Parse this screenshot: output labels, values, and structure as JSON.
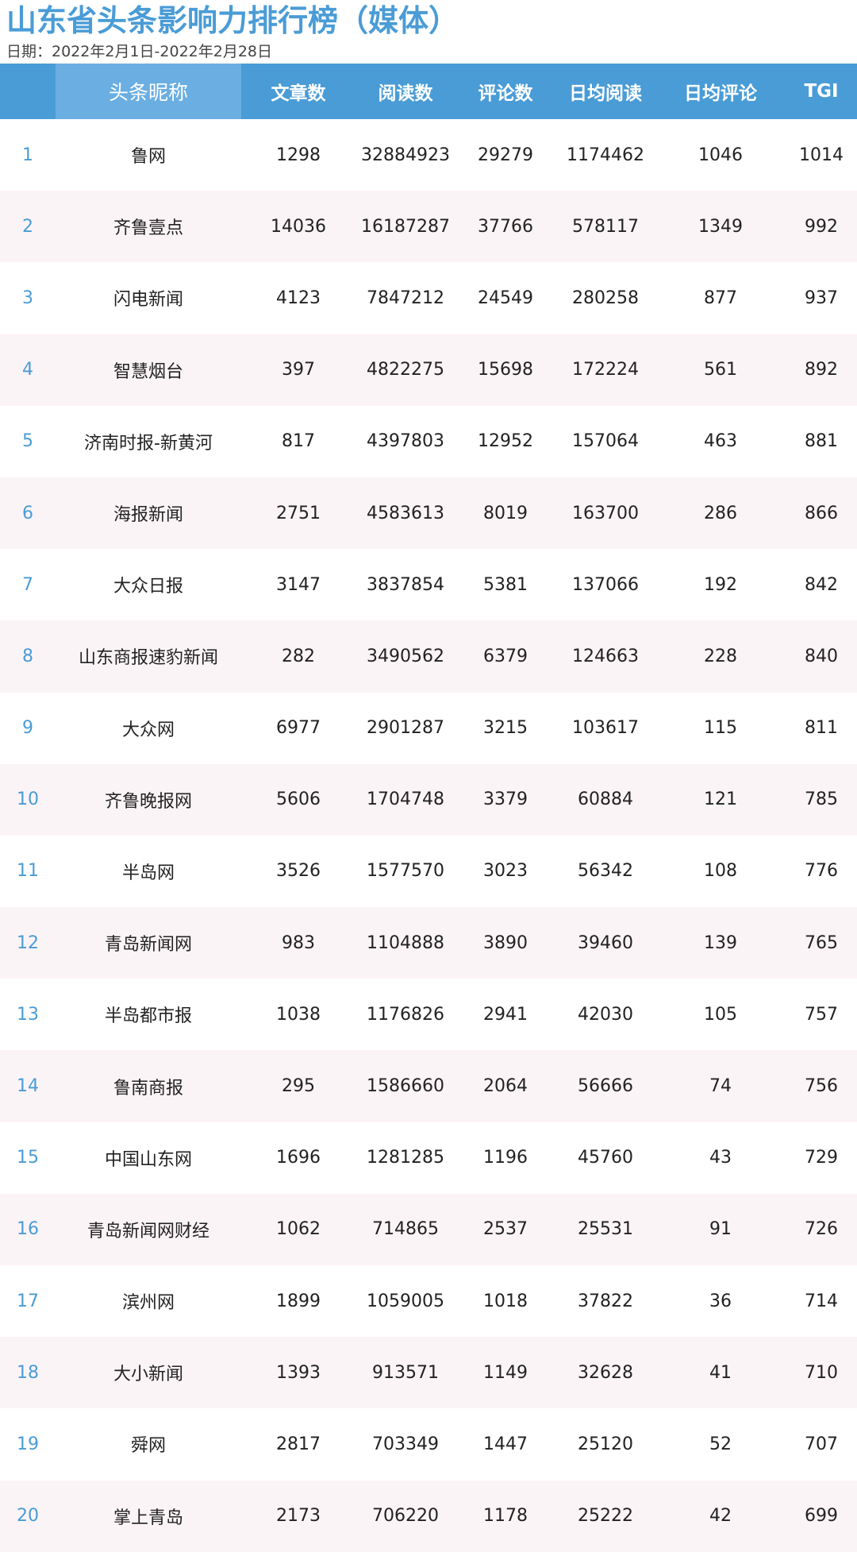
{
  "title": "山东省头条影响力排行榜（媒体）",
  "date_line": "日期：2022年2月1日-2022年2月28日",
  "columns": {
    "rank": "",
    "nickname": "头条昵称",
    "articles": "文章数",
    "reads": "阅读数",
    "comments": "评论数",
    "daily_reads": "日均阅读",
    "daily_comments": "日均评论",
    "tgi": "TGI"
  },
  "colors": {
    "header_bg": "#4a9cd6",
    "header_nick_bg": "#6aaee2",
    "title": "#4a9cd6",
    "row_alt": "#fbf4f6"
  },
  "rows": [
    {
      "rank": "1",
      "nickname": "鲁网",
      "articles": "1298",
      "reads": "32884923",
      "comments": "29279",
      "daily_reads": "1174462",
      "daily_comments": "1046",
      "tgi": "1014"
    },
    {
      "rank": "2",
      "nickname": "齐鲁壹点",
      "articles": "14036",
      "reads": "16187287",
      "comments": "37766",
      "daily_reads": "578117",
      "daily_comments": "1349",
      "tgi": "992"
    },
    {
      "rank": "3",
      "nickname": "闪电新闻",
      "articles": "4123",
      "reads": "7847212",
      "comments": "24549",
      "daily_reads": "280258",
      "daily_comments": "877",
      "tgi": "937"
    },
    {
      "rank": "4",
      "nickname": "智慧烟台",
      "articles": "397",
      "reads": "4822275",
      "comments": "15698",
      "daily_reads": "172224",
      "daily_comments": "561",
      "tgi": "892"
    },
    {
      "rank": "5",
      "nickname": "济南时报-新黄河",
      "articles": "817",
      "reads": "4397803",
      "comments": "12952",
      "daily_reads": "157064",
      "daily_comments": "463",
      "tgi": "881"
    },
    {
      "rank": "6",
      "nickname": "海报新闻",
      "articles": "2751",
      "reads": "4583613",
      "comments": "8019",
      "daily_reads": "163700",
      "daily_comments": "286",
      "tgi": "866"
    },
    {
      "rank": "7",
      "nickname": "大众日报",
      "articles": "3147",
      "reads": "3837854",
      "comments": "5381",
      "daily_reads": "137066",
      "daily_comments": "192",
      "tgi": "842"
    },
    {
      "rank": "8",
      "nickname": "山东商报速豹新闻",
      "articles": "282",
      "reads": "3490562",
      "comments": "6379",
      "daily_reads": "124663",
      "daily_comments": "228",
      "tgi": "840"
    },
    {
      "rank": "9",
      "nickname": "大众网",
      "articles": "6977",
      "reads": "2901287",
      "comments": "3215",
      "daily_reads": "103617",
      "daily_comments": "115",
      "tgi": "811"
    },
    {
      "rank": "10",
      "nickname": "齐鲁晚报网",
      "articles": "5606",
      "reads": "1704748",
      "comments": "3379",
      "daily_reads": "60884",
      "daily_comments": "121",
      "tgi": "785"
    },
    {
      "rank": "11",
      "nickname": "半岛网",
      "articles": "3526",
      "reads": "1577570",
      "comments": "3023",
      "daily_reads": "56342",
      "daily_comments": "108",
      "tgi": "776"
    },
    {
      "rank": "12",
      "nickname": "青岛新闻网",
      "articles": "983",
      "reads": "1104888",
      "comments": "3890",
      "daily_reads": "39460",
      "daily_comments": "139",
      "tgi": "765"
    },
    {
      "rank": "13",
      "nickname": "半岛都市报",
      "articles": "1038",
      "reads": "1176826",
      "comments": "2941",
      "daily_reads": "42030",
      "daily_comments": "105",
      "tgi": "757"
    },
    {
      "rank": "14",
      "nickname": "鲁南商报",
      "articles": "295",
      "reads": "1586660",
      "comments": "2064",
      "daily_reads": "56666",
      "daily_comments": "74",
      "tgi": "756"
    },
    {
      "rank": "15",
      "nickname": "中国山东网",
      "articles": "1696",
      "reads": "1281285",
      "comments": "1196",
      "daily_reads": "45760",
      "daily_comments": "43",
      "tgi": "729"
    },
    {
      "rank": "16",
      "nickname": "青岛新闻网财经",
      "articles": "1062",
      "reads": "714865",
      "comments": "2537",
      "daily_reads": "25531",
      "daily_comments": "91",
      "tgi": "726"
    },
    {
      "rank": "17",
      "nickname": "滨州网",
      "articles": "1899",
      "reads": "1059005",
      "comments": "1018",
      "daily_reads": "37822",
      "daily_comments": "36",
      "tgi": "714"
    },
    {
      "rank": "18",
      "nickname": "大小新闻",
      "articles": "1393",
      "reads": "913571",
      "comments": "1149",
      "daily_reads": "32628",
      "daily_comments": "41",
      "tgi": "710"
    },
    {
      "rank": "19",
      "nickname": "舜网",
      "articles": "2817",
      "reads": "703349",
      "comments": "1447",
      "daily_reads": "25120",
      "daily_comments": "52",
      "tgi": "707"
    },
    {
      "rank": "20",
      "nickname": "掌上青岛",
      "articles": "2173",
      "reads": "706220",
      "comments": "1178",
      "daily_reads": "25222",
      "daily_comments": "42",
      "tgi": "699"
    }
  ]
}
